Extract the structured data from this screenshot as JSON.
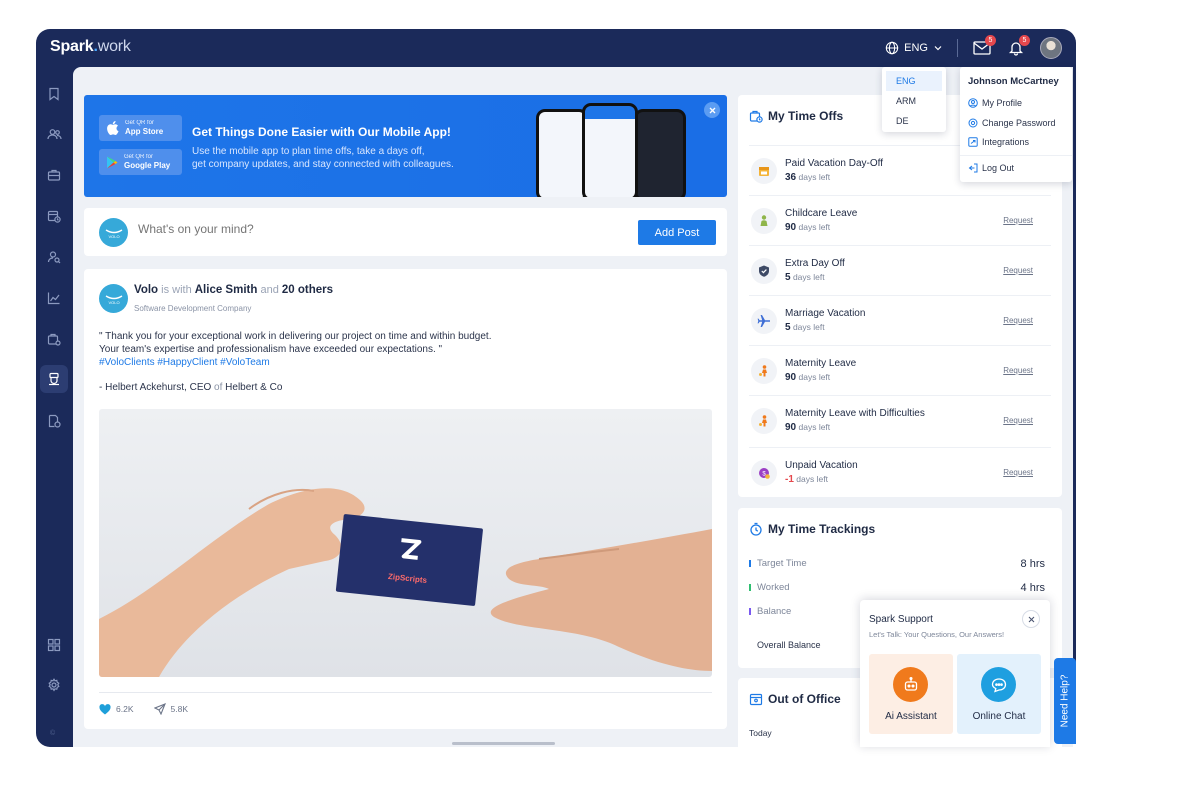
{
  "brand": {
    "name": "Spark",
    "dot": ".",
    "suffix": "work"
  },
  "topbar": {
    "language": "ENG",
    "mail_count": "5",
    "notif_count": "5"
  },
  "language_menu": {
    "options": [
      "ENG",
      "ARM",
      "DE"
    ],
    "selected": "ENG"
  },
  "user_menu": {
    "name": "Johnson McCartney",
    "items": [
      "My Profile",
      "Change Password",
      "Integrations",
      "Log Out"
    ]
  },
  "sidebar": {
    "version": "©"
  },
  "promo": {
    "app_store_small": "Get QR for",
    "app_store_label": "App Store",
    "google_small": "Get QR for",
    "google_label": "Google Play",
    "title": "Get Things Done Easier with Our Mobile App!",
    "text_line1": "Use the mobile app to plan time offs, take a days off,",
    "text_line2": "get company updates, and stay connected with colleagues."
  },
  "composer": {
    "placeholder": "What's on your mind?",
    "button": "Add Post",
    "logo": "VOLO"
  },
  "post": {
    "author": "Volo",
    "is_with": "is with",
    "tagged": "Alice Smith",
    "and": "and",
    "others": "20 others",
    "company": "Software Development Company",
    "line1": "\" Thank you for your exceptional work in delivering our project on time and within budget.",
    "line2": "Your team's expertise and professionalism have exceeded our expectations. \"",
    "tags": "#VoloClients #HappyClient #VoloTeam",
    "signature": "- Helbert Ackehurst, CEO",
    "sig_of": "of",
    "sig_company": "Helbert & Co",
    "card_brand": "ZipScripts",
    "likes": "6.2K",
    "shares": "5.8K"
  },
  "time_offs": {
    "title": "My Time Offs",
    "days_left": "days left",
    "request": "Request",
    "items": [
      {
        "name": "Paid Vacation Day-Off",
        "days": "36"
      },
      {
        "name": "Childcare Leave",
        "days": "90"
      },
      {
        "name": "Extra Day Off",
        "days": "5"
      },
      {
        "name": "Marriage Vacation",
        "days": "5"
      },
      {
        "name": "Maternity Leave",
        "days": "90"
      },
      {
        "name": "Maternity Leave with Difficulties",
        "days": "90"
      },
      {
        "name": "Unpaid Vacation",
        "days": "-1"
      }
    ]
  },
  "time_tracking": {
    "title": "My Time Trackings",
    "rows": [
      {
        "label": "Target Time",
        "value": "8 hrs"
      },
      {
        "label": "Worked",
        "value": "4 hrs"
      },
      {
        "label": "Balance",
        "value": ""
      }
    ],
    "overall": "Overall Balance"
  },
  "out_of_office": {
    "title": "Out of Office",
    "today": "Today"
  },
  "support": {
    "title": "Spark Support",
    "subtitle": "Let's Talk: Your Questions, Our Answers!",
    "ai": "Ai Assistant",
    "chat": "Online Chat",
    "help_tab": "Need Help?"
  },
  "colors": {
    "navy": "#1b2a5a",
    "accent": "#1e7ae6",
    "danger": "#e5484d",
    "ai_orange": "#f07a1c"
  }
}
